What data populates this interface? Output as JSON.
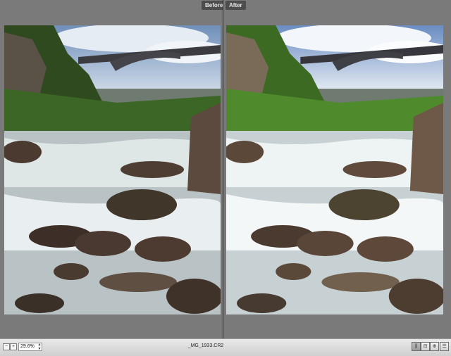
{
  "panes": {
    "before_label": "Before",
    "after_label": "After"
  },
  "statusbar": {
    "zoom_out_icon": "minus-icon",
    "zoom_in_icon": "plus-icon",
    "zoom_value": "29.6%",
    "filename": "_MG_1933.CR2",
    "view_buttons": [
      "split-vertical-icon",
      "split-horizontal-icon",
      "swipe-icon",
      "menu-icon"
    ]
  },
  "colors": {
    "pane_background": "#7a7a7a",
    "status_bar": "#e0e0e0",
    "tab_background": "#4d4d4d"
  }
}
